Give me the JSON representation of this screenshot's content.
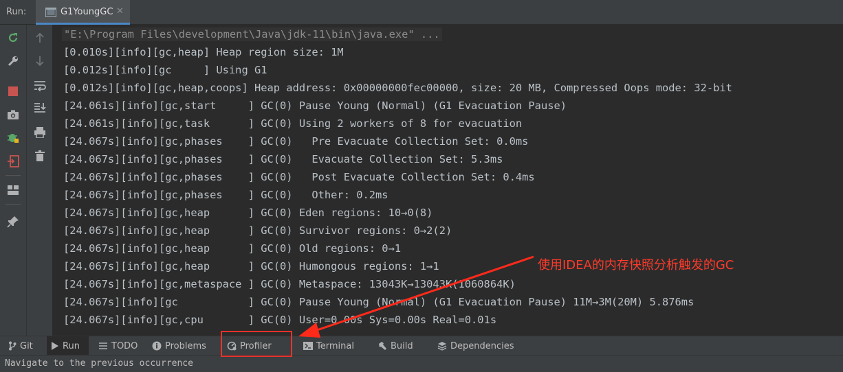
{
  "topbar": {
    "run_label": "Run:",
    "tab_title": "G1YoungGC"
  },
  "console": {
    "command": "\"E:\\Program Files\\development\\Java\\jdk-11\\bin\\java.exe\" ...",
    "lines": [
      "[0.010s][info][gc,heap] Heap region size: 1M",
      "[0.012s][info][gc     ] Using G1",
      "[0.012s][info][gc,heap,coops] Heap address: 0x00000000fec00000, size: 20 MB, Compressed Oops mode: 32-bit",
      "[24.061s][info][gc,start     ] GC(0) Pause Young (Normal) (G1 Evacuation Pause)",
      "[24.061s][info][gc,task      ] GC(0) Using 2 workers of 8 for evacuation",
      "[24.067s][info][gc,phases    ] GC(0)   Pre Evacuate Collection Set: 0.0ms",
      "[24.067s][info][gc,phases    ] GC(0)   Evacuate Collection Set: 5.3ms",
      "[24.067s][info][gc,phases    ] GC(0)   Post Evacuate Collection Set: 0.4ms",
      "[24.067s][info][gc,phases    ] GC(0)   Other: 0.2ms",
      "[24.067s][info][gc,heap      ] GC(0) Eden regions: 10→0(8)",
      "[24.067s][info][gc,heap      ] GC(0) Survivor regions: 0→2(2)",
      "[24.067s][info][gc,heap      ] GC(0) Old regions: 0→1",
      "[24.067s][info][gc,heap      ] GC(0) Humongous regions: 1→1",
      "[24.067s][info][gc,metaspace ] GC(0) Metaspace: 13043K→13043K(1060864K)",
      "[24.067s][info][gc           ] GC(0) Pause Young (Normal) (G1 Evacuation Pause) 11M→3M(20M) 5.876ms",
      "[24.067s][info][gc,cpu       ] GC(0) User=0.00s Sys=0.00s Real=0.01s"
    ]
  },
  "bottom_tabs": [
    {
      "label": "Git",
      "icon": "git-branch-icon"
    },
    {
      "label": "Run",
      "icon": "run-play-icon"
    },
    {
      "label": "TODO",
      "icon": "todo-list-icon"
    },
    {
      "label": "Problems",
      "icon": "problems-info-icon"
    },
    {
      "label": "Profiler",
      "icon": "profiler-gauge-icon"
    },
    {
      "label": "Terminal",
      "icon": "terminal-icon"
    },
    {
      "label": "Build",
      "icon": "hammer-icon"
    },
    {
      "label": "Dependencies",
      "icon": "layers-icon"
    }
  ],
  "status": {
    "text": "Navigate to the previous occurrence"
  },
  "annotation": {
    "text": "使用IDEA的内存快照分析触发的GC"
  },
  "colors": {
    "annotation_red": "#ff3a2a",
    "tab_underline": "#4a88c7",
    "rerun_green": "#59a869",
    "stop_red": "#c75450"
  }
}
